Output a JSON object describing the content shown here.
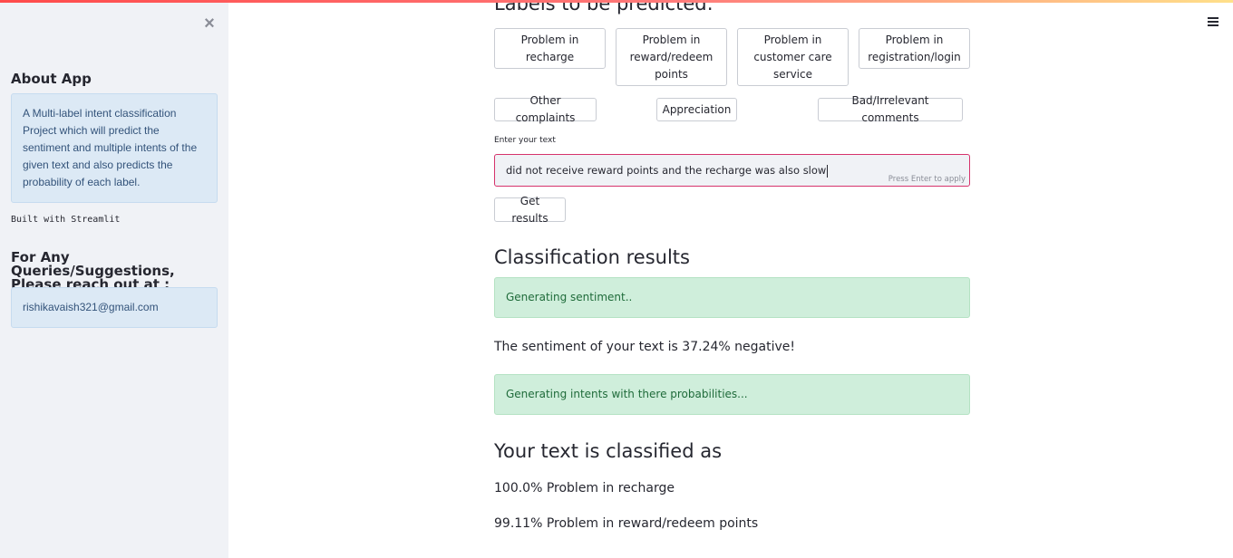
{
  "sidebar": {
    "close_icon": "×",
    "about_title": "About App",
    "about_text": "A Multi-label intent classification Project which will predict the sentiment and multiple intents of the given text and also predicts the probability of each label.",
    "built_with": "Built with Streamlit",
    "queries_title": "For Any Queries/Suggestions, Please reach out at :",
    "email": "rishikavaish321@gmail.com"
  },
  "main": {
    "labels_heading": "Labels to be predicted:",
    "labels": [
      "Problem in recharge",
      "Problem in reward/redeem points",
      "Problem in customer care service",
      "Problem in registration/login",
      "Other complaints",
      "Appreciation",
      "Bad/Irrelevant comments"
    ],
    "input": {
      "label": "Enter your text",
      "value": "did not receive reward points and the recharge was also slow",
      "hint": "Press Enter to apply"
    },
    "get_results_label": "Get results",
    "results_heading": "Classification results",
    "status_sentiment": "Generating sentiment..",
    "sentiment_text": "The sentiment of your text is 37.24% negative!",
    "status_intents": "Generating intents with there probabilities...",
    "classified_heading": "Your text is classified as",
    "results": [
      "100.0% Problem in recharge",
      "99.11% Problem in reward/redeem points"
    ]
  },
  "colors": {
    "accent": "#ff4b4b",
    "sidebar_bg": "#f0f2f6",
    "info_bg": "#dce9f5",
    "success_bg": "#cfeedb",
    "input_border": "#d6336c"
  },
  "icons": {
    "close": "close-icon",
    "menu": "hamburger-menu-icon"
  }
}
